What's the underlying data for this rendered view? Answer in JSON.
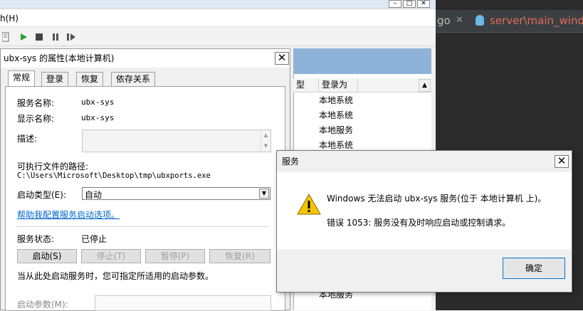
{
  "services_window": {
    "menu_fragment": "h(H)",
    "columns": [
      "型",
      "登录为"
    ],
    "logon_rows": [
      "本地系统",
      "本地系统",
      "本地服务",
      "本地系统"
    ],
    "logon_bottom": "本地服务"
  },
  "editor": {
    "tab_left": "go",
    "tab_active": "server\\main_wind"
  },
  "properties_dialog": {
    "title": "ubx-sys 的属性(本地计算机)",
    "tabs": [
      "常规",
      "登录",
      "恢复",
      "依存关系"
    ],
    "service_name_label": "服务名称:",
    "service_name_value": "ubx-sys",
    "display_name_label": "显示名称:",
    "display_name_value": "ubx-sys",
    "description_label": "描述:",
    "exe_path_label": "可执行文件的路径:",
    "exe_path_value": "C:\\Users\\Microsoft\\Desktop\\tmp\\ubxports.exe",
    "startup_type_label": "启动类型(E):",
    "startup_type_value": "自动",
    "help_link": "帮助我配置服务启动选项。",
    "status_label": "服务状态:",
    "status_value": "已停止",
    "buttons": {
      "start": "启动(S)",
      "stop": "停止(T)",
      "pause": "暂停(P)",
      "resume": "恢复(R)"
    },
    "start_params_hint": "当从此处启动服务时，您可指定所适用的启动参数。",
    "start_params_label": "启动参数(M):"
  },
  "error_dialog": {
    "title": "服务",
    "message": "Windows 无法启动 ubx-sys 服务(位于 本地计算机 上)。",
    "detail": "错误 1053: 服务没有及时响应启动或控制请求。",
    "ok_label": "确定"
  },
  "colors": {
    "link": "#0066cc",
    "editor_bg": "#2b2b2b",
    "editor_tab_text": "#e06c5a",
    "list_header_bg": "#8fb3d8",
    "warning_yellow": "#f5c400"
  }
}
